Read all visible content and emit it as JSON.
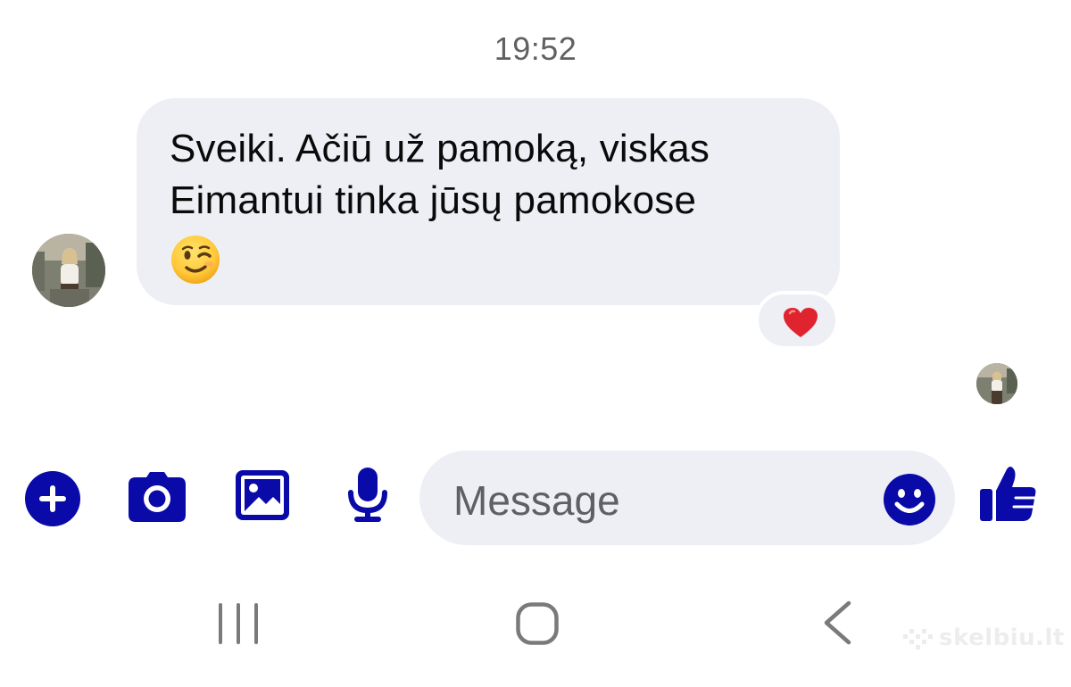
{
  "conversation": {
    "timestamp": "19:52",
    "messages": [
      {
        "direction": "incoming",
        "text": "Sveiki. Ačiū už pamoką, viskas\nEimantui tinka jūsų pamokose",
        "emoji": "winking-face",
        "reaction": "red-heart"
      }
    ],
    "seen_indicator": "avatar"
  },
  "composer": {
    "placeholder": "Message",
    "icons": [
      "plus-icon",
      "camera-icon",
      "gallery-icon",
      "microphone-icon",
      "emoji-icon",
      "thumbs-up-icon"
    ],
    "accent_color": "#0a0aa8"
  },
  "navigation_bar": {
    "buttons": [
      "recents",
      "home",
      "back"
    ]
  },
  "watermark": {
    "text": "skelbiu.lt"
  },
  "colors": {
    "bubble_background": "#eeeff5",
    "timestamp_text": "#616161",
    "accent": "#0a0aa8",
    "heart": "#e0242f"
  }
}
